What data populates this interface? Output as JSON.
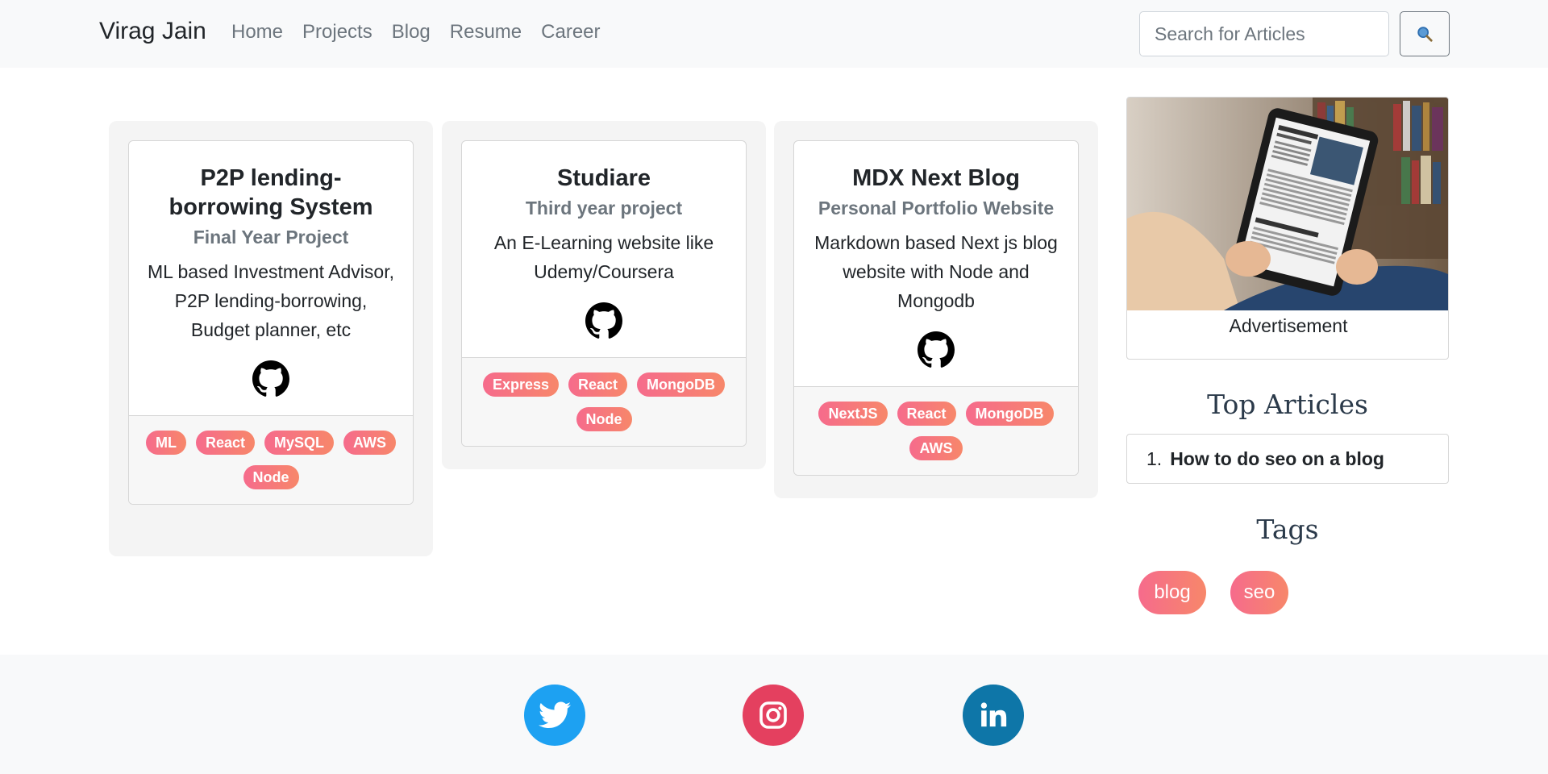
{
  "navbar": {
    "brand": "Virag Jain",
    "links": [
      "Home",
      "Projects",
      "Blog",
      "Resume",
      "Career"
    ],
    "search_placeholder": "Search for Articles"
  },
  "projects": [
    {
      "title": "P2P lending-borrowing System",
      "subtitle": "Final Year Project",
      "description": "ML based Investment Advisor, P2P lending-borrowing, Budget planner, etc",
      "tags": [
        "ML",
        "React",
        "MySQL",
        "AWS",
        "Node"
      ]
    },
    {
      "title": "Studiare",
      "subtitle": "Third year project",
      "description": "An E-Learning website like Udemy/Coursera",
      "tags": [
        "Express",
        "React",
        "MongoDB",
        "Node"
      ]
    },
    {
      "title": "MDX Next Blog",
      "subtitle": "Personal Portfolio Website",
      "description": "Markdown based Next js blog website with Node and Mongodb",
      "tags": [
        "NextJS",
        "React",
        "MongoDB",
        "AWS"
      ]
    }
  ],
  "sidebar": {
    "ad_label": "Advertisement",
    "top_articles_heading": "Top Articles",
    "top_articles": [
      {
        "number": "1.",
        "title": "How to do seo on a blog"
      }
    ],
    "tags_heading": "Tags",
    "tags": [
      "blog",
      "seo"
    ]
  },
  "footer": {
    "socials": [
      {
        "name": "twitter-icon",
        "color": "#1da1f2"
      },
      {
        "name": "instagram-icon",
        "color": "#e4405f"
      },
      {
        "name": "linkedin-icon",
        "color": "#0e76a8"
      }
    ]
  },
  "colors": {
    "chip_gradient_start": "#f66b8c",
    "chip_gradient_end": "#f7876a",
    "navbar_bg": "#f8f9fa"
  }
}
